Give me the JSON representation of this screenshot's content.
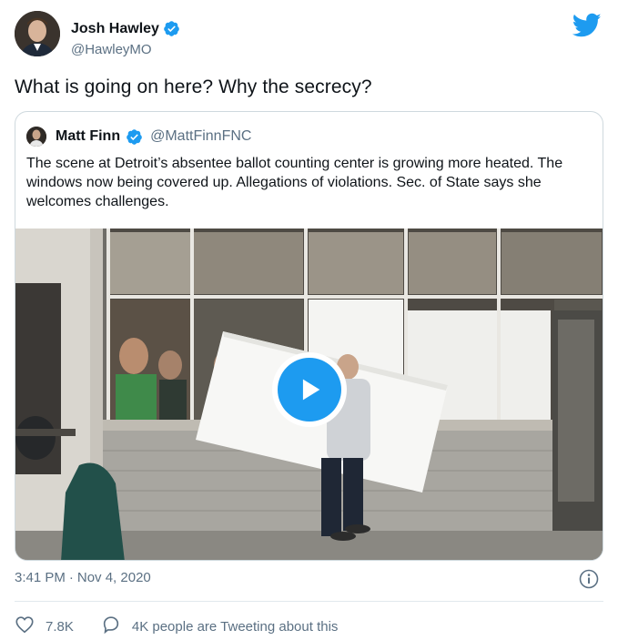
{
  "author": {
    "name": "Josh Hawley",
    "handle": "@HawleyMO"
  },
  "tweet": {
    "text": "What is going on here? Why the secrecy?",
    "time": "3:41 PM",
    "separator": "·",
    "date": "Nov 4, 2020"
  },
  "quoted": {
    "name": "Matt Finn",
    "handle": "@MattFinnFNC",
    "text": "The scene at Detroit’s absentee ballot counting center is growing more heated.  The windows now being covered up. Allegations of violations. Sec. of State says she welcomes challenges."
  },
  "actions": {
    "likes": "7.8K",
    "tweeting": "4K people are Tweeting about this"
  },
  "icons": {
    "verified": "verified-badge-icon",
    "logo": "twitter-bird-icon",
    "play": "play-icon",
    "info": "info-icon",
    "like": "heart-icon",
    "reply": "speech-bubble-icon"
  },
  "colors": {
    "accent": "#1d9bf0",
    "secondary_text": "#5b7083",
    "border": "#cfd9de"
  }
}
